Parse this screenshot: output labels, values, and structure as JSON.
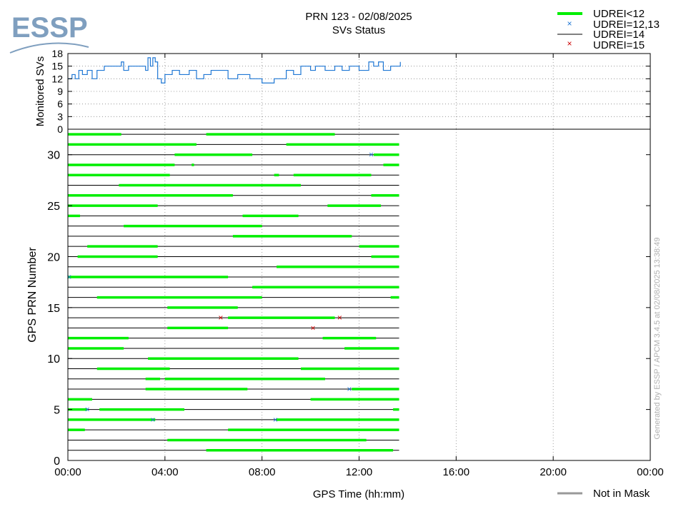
{
  "header": {
    "logo_text": "ESSP",
    "title_line1": "PRN 123 - 02/08/2025",
    "title_line2": "SVs Status"
  },
  "footer": {
    "generated_by": "Generated by ESSP / APCM 3.4.5 at 02/08/2025 13:38:49",
    "not_in_mask": "Not in Mask"
  },
  "colors": {
    "udrei_lt12": "#00ee00",
    "udrei_12_13": "#1f77d4",
    "udrei_14": "#000000",
    "udrei_15": "#cc0000",
    "monitored_line": "#1f77d4",
    "not_in_mask": "#999999",
    "logo": "#7f9fbf"
  },
  "chart_data": [
    {
      "id": "monitored",
      "type": "line",
      "title": "PRN 123 - 02/08/2025 SVs Status",
      "ylabel": "Monitored SVs",
      "ylim": [
        0,
        18
      ],
      "yticks": [
        0,
        3,
        6,
        9,
        12,
        15,
        18
      ],
      "x_unit": "hours",
      "xlim": [
        0,
        24
      ],
      "grid": true,
      "series": [
        {
          "x": [
            0,
            0.17,
            0.3,
            0.45,
            0.6,
            0.8,
            1.0,
            1.2,
            1.5,
            1.9,
            2.2,
            2.3,
            2.5,
            3.0,
            3.2,
            3.3,
            3.4,
            3.5,
            3.6,
            3.7,
            3.85,
            4.0,
            4.3,
            4.6,
            5.0,
            5.3,
            5.6,
            5.9,
            6.3,
            6.6,
            7.0,
            7.5,
            7.9,
            8.0,
            8.5,
            9.0,
            9.3,
            9.6,
            10.0,
            10.2,
            10.6,
            11.0,
            11.3,
            11.6,
            12.0,
            12.4,
            12.6,
            12.8,
            13.0,
            13.3,
            13.7
          ],
          "y": [
            12,
            13,
            12,
            14,
            13,
            14,
            12,
            14,
            15,
            15,
            16,
            14,
            15,
            15,
            14,
            17,
            15,
            17,
            16,
            12,
            11,
            13,
            14,
            13,
            14,
            12,
            13,
            14,
            14,
            12,
            13,
            12,
            12,
            11,
            12,
            14,
            13,
            15,
            14,
            15,
            14,
            15,
            14,
            15,
            14,
            16,
            15,
            16,
            14,
            15,
            16
          ]
        }
      ]
    },
    {
      "id": "prn_status",
      "type": "timeline",
      "xlabel": "GPS Time (hh:mm)",
      "ylabel": "GPS PRN Number",
      "xlim": [
        0,
        24
      ],
      "x_unit": "hours",
      "xticks": [
        "00:00",
        "04:00",
        "08:00",
        "12:00",
        "16:00",
        "20:00",
        "00:00"
      ],
      "ylim": [
        0,
        32.5
      ],
      "yticks": [
        0,
        5,
        10,
        15,
        20,
        25,
        30
      ],
      "data_end": 13.65,
      "grid": true,
      "legend": {
        "placement": "top-right",
        "entries": [
          {
            "label": "UDREI<12",
            "marker": "thick-line"
          },
          {
            "label": "UDREI=12,13",
            "marker": "x-blue"
          },
          {
            "label": "UDREI=14",
            "marker": "thin-line"
          },
          {
            "label": "UDREI=15",
            "marker": "x-red"
          }
        ]
      },
      "prns": [
        {
          "prn": 1,
          "segs": [
            [
              5.7,
              13.4
            ]
          ],
          "blue": [],
          "red": []
        },
        {
          "prn": 2,
          "segs": [
            [
              4.1,
              12.3
            ]
          ],
          "blue": [],
          "red": []
        },
        {
          "prn": 3,
          "segs": [
            [
              0,
              0.7
            ],
            [
              6.6,
              13.65
            ]
          ],
          "blue": [],
          "red": []
        },
        {
          "prn": 4,
          "segs": [
            [
              0,
              3.6
            ],
            [
              8.6,
              13.65
            ]
          ],
          "blue": [
            3.5,
            8.55
          ],
          "red": []
        },
        {
          "prn": 5,
          "segs": [
            [
              0,
              0.8
            ],
            [
              1.3,
              4.8
            ],
            [
              13.4,
              13.65
            ]
          ],
          "blue": [
            0.8
          ],
          "red": []
        },
        {
          "prn": 6,
          "segs": [
            [
              0,
              1.0
            ],
            [
              10.0,
              13.65
            ]
          ],
          "blue": [],
          "red": []
        },
        {
          "prn": 7,
          "segs": [
            [
              3.2,
              7.4
            ],
            [
              11.7,
              13.65
            ]
          ],
          "blue": [
            11.6
          ],
          "red": []
        },
        {
          "prn": 8,
          "segs": [
            [
              3.2,
              3.8
            ],
            [
              4.0,
              10.6
            ]
          ],
          "blue": [],
          "red": []
        },
        {
          "prn": 9,
          "segs": [
            [
              1.2,
              4.2
            ],
            [
              9.6,
              13.65
            ]
          ],
          "blue": [],
          "red": []
        },
        {
          "prn": 10,
          "segs": [
            [
              3.3,
              9.5
            ]
          ],
          "blue": [],
          "red": []
        },
        {
          "prn": 11,
          "segs": [
            [
              0,
              2.3
            ],
            [
              11.4,
              13.65
            ]
          ],
          "blue": [],
          "red": []
        },
        {
          "prn": 12,
          "segs": [
            [
              0,
              2.5
            ],
            [
              10.5,
              12.7
            ]
          ],
          "blue": [],
          "red": []
        },
        {
          "prn": 13,
          "segs": [
            [
              4.1,
              6.6
            ]
          ],
          "blue": [],
          "red": [
            10.1
          ]
        },
        {
          "prn": 14,
          "segs": [
            [
              6.6,
              11.0
            ]
          ],
          "blue": [],
          "red": [
            6.3,
            11.2
          ]
        },
        {
          "prn": 15,
          "segs": [
            [
              4.1,
              7.0
            ]
          ],
          "blue": [],
          "red": []
        },
        {
          "prn": 16,
          "segs": [
            [
              1.2,
              8.0
            ],
            [
              13.3,
              13.65
            ]
          ],
          "blue": [],
          "red": []
        },
        {
          "prn": 17,
          "segs": [
            [
              7.6,
              13.65
            ]
          ],
          "blue": [],
          "red": []
        },
        {
          "prn": 18,
          "segs": [
            [
              0,
              6.6
            ]
          ],
          "blue": [
            0.05
          ],
          "red": []
        },
        {
          "prn": 19,
          "segs": [
            [
              8.6,
              13.65
            ]
          ],
          "blue": [],
          "red": []
        },
        {
          "prn": 20,
          "segs": [
            [
              0.4,
              3.7
            ],
            [
              12.5,
              13.65
            ]
          ],
          "blue": [],
          "red": []
        },
        {
          "prn": 21,
          "segs": [
            [
              0.8,
              3.7
            ],
            [
              12.0,
              13.65
            ]
          ],
          "blue": [],
          "red": []
        },
        {
          "prn": 22,
          "segs": [
            [
              6.8,
              11.7
            ]
          ],
          "blue": [],
          "red": []
        },
        {
          "prn": 23,
          "segs": [
            [
              2.3,
              8.0
            ]
          ],
          "blue": [],
          "red": []
        },
        {
          "prn": 24,
          "segs": [
            [
              0,
              0.5
            ],
            [
              7.2,
              9.5
            ]
          ],
          "blue": [],
          "red": []
        },
        {
          "prn": 25,
          "segs": [
            [
              0,
              3.7
            ],
            [
              10.7,
              12.9
            ]
          ],
          "blue": [],
          "red": []
        },
        {
          "prn": 26,
          "segs": [
            [
              0,
              6.8
            ],
            [
              12.5,
              13.65
            ]
          ],
          "blue": [],
          "red": []
        },
        {
          "prn": 27,
          "segs": [
            [
              2.1,
              9.6
            ]
          ],
          "blue": [],
          "red": []
        },
        {
          "prn": 28,
          "segs": [
            [
              0,
              4.2
            ],
            [
              8.5,
              8.7
            ],
            [
              9.3,
              12.5
            ]
          ],
          "blue": [],
          "red": []
        },
        {
          "prn": 29,
          "segs": [
            [
              0,
              4.4
            ],
            [
              5.1,
              5.2
            ],
            [
              13.0,
              13.65
            ]
          ],
          "blue": [],
          "red": []
        },
        {
          "prn": 30,
          "segs": [
            [
              4.4,
              7.6
            ],
            [
              12.6,
              13.65
            ]
          ],
          "blue": [
            12.5
          ],
          "red": []
        },
        {
          "prn": 31,
          "segs": [
            [
              0,
              5.3
            ],
            [
              9.0,
              13.65
            ]
          ],
          "blue": [],
          "red": []
        },
        {
          "prn": 32,
          "segs": [
            [
              0,
              2.2
            ],
            [
              5.7,
              11.0
            ]
          ],
          "blue": [],
          "red": []
        }
      ]
    }
  ]
}
